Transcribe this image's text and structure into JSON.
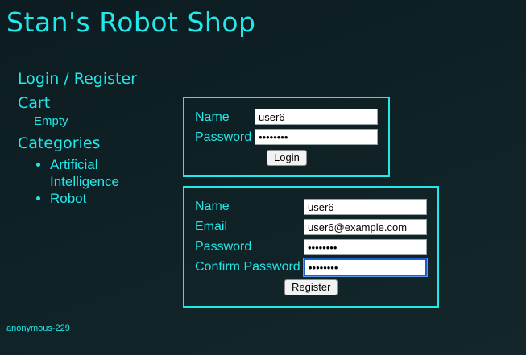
{
  "header": {
    "title": "Stan's Robot Shop"
  },
  "nav": {
    "login_register": "Login / Register",
    "cart_label": "Cart",
    "cart_status": "Empty",
    "categories_label": "Categories",
    "categories": [
      "Artificial Intelligence",
      "Robot"
    ]
  },
  "login_form": {
    "name_label": "Name",
    "name_value": "user6",
    "password_label": "Password",
    "password_value": "••••••••",
    "submit_label": "Login"
  },
  "register_form": {
    "name_label": "Name",
    "name_value": "user6",
    "email_label": "Email",
    "email_value": "user6@example.com",
    "password_label": "Password",
    "password_value": "••••••••",
    "confirm_label": "Confirm Password",
    "confirm_value": "••••••••",
    "submit_label": "Register"
  },
  "footer": {
    "user_id": "anonymous-229"
  },
  "colors": {
    "accent": "#22e8ea",
    "background": "#0f2125",
    "focus_ring": "#1a5fd0"
  }
}
